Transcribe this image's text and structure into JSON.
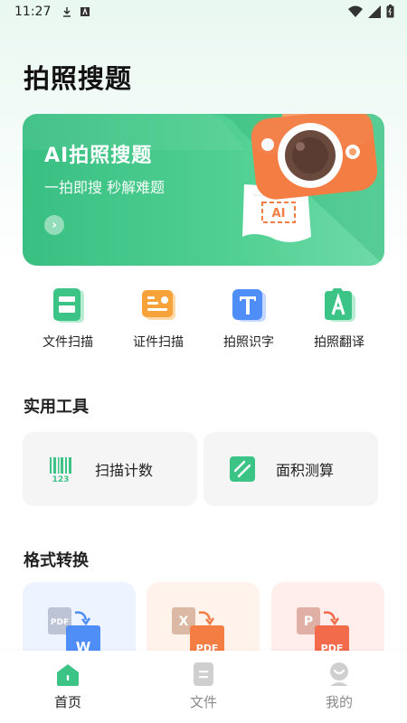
{
  "status_bar": {
    "time": "11:27"
  },
  "page": {
    "title": "拍照搜题"
  },
  "banner": {
    "title": "AI拍照搜题",
    "subtitle": "一拍即搜 秒解难题",
    "camera_label": "AI",
    "arrow_glyph": "›"
  },
  "quick_actions": [
    {
      "label": "文件扫描",
      "icon": "document-scan-icon"
    },
    {
      "label": "证件扫描",
      "icon": "id-card-icon"
    },
    {
      "label": "拍照识字",
      "icon": "text-recognition-icon"
    },
    {
      "label": "拍照翻译",
      "icon": "translate-icon"
    }
  ],
  "tools_section": {
    "title": "实用工具",
    "items": [
      {
        "label": "扫描计数",
        "icon": "barcode-count-icon"
      },
      {
        "label": "面积测算",
        "icon": "area-measure-icon"
      }
    ]
  },
  "convert_section": {
    "title": "格式转换",
    "items": [
      {
        "from": "PDF",
        "to": "W",
        "icon": "pdf-to-word-icon"
      },
      {
        "from": "X",
        "to": "PDF",
        "icon": "excel-to-pdf-icon"
      },
      {
        "from": "P",
        "to": "PDF",
        "icon": "ppt-to-pdf-icon"
      }
    ]
  },
  "tabbar": {
    "tabs": [
      {
        "label": "首页",
        "active": true
      },
      {
        "label": "文件",
        "active": false
      },
      {
        "label": "我的",
        "active": false
      }
    ]
  },
  "colors": {
    "brand_green": "#3cc486",
    "orange": "#f47d43",
    "blue": "#4f8df7",
    "gray_tab": "#c8c8c8"
  }
}
